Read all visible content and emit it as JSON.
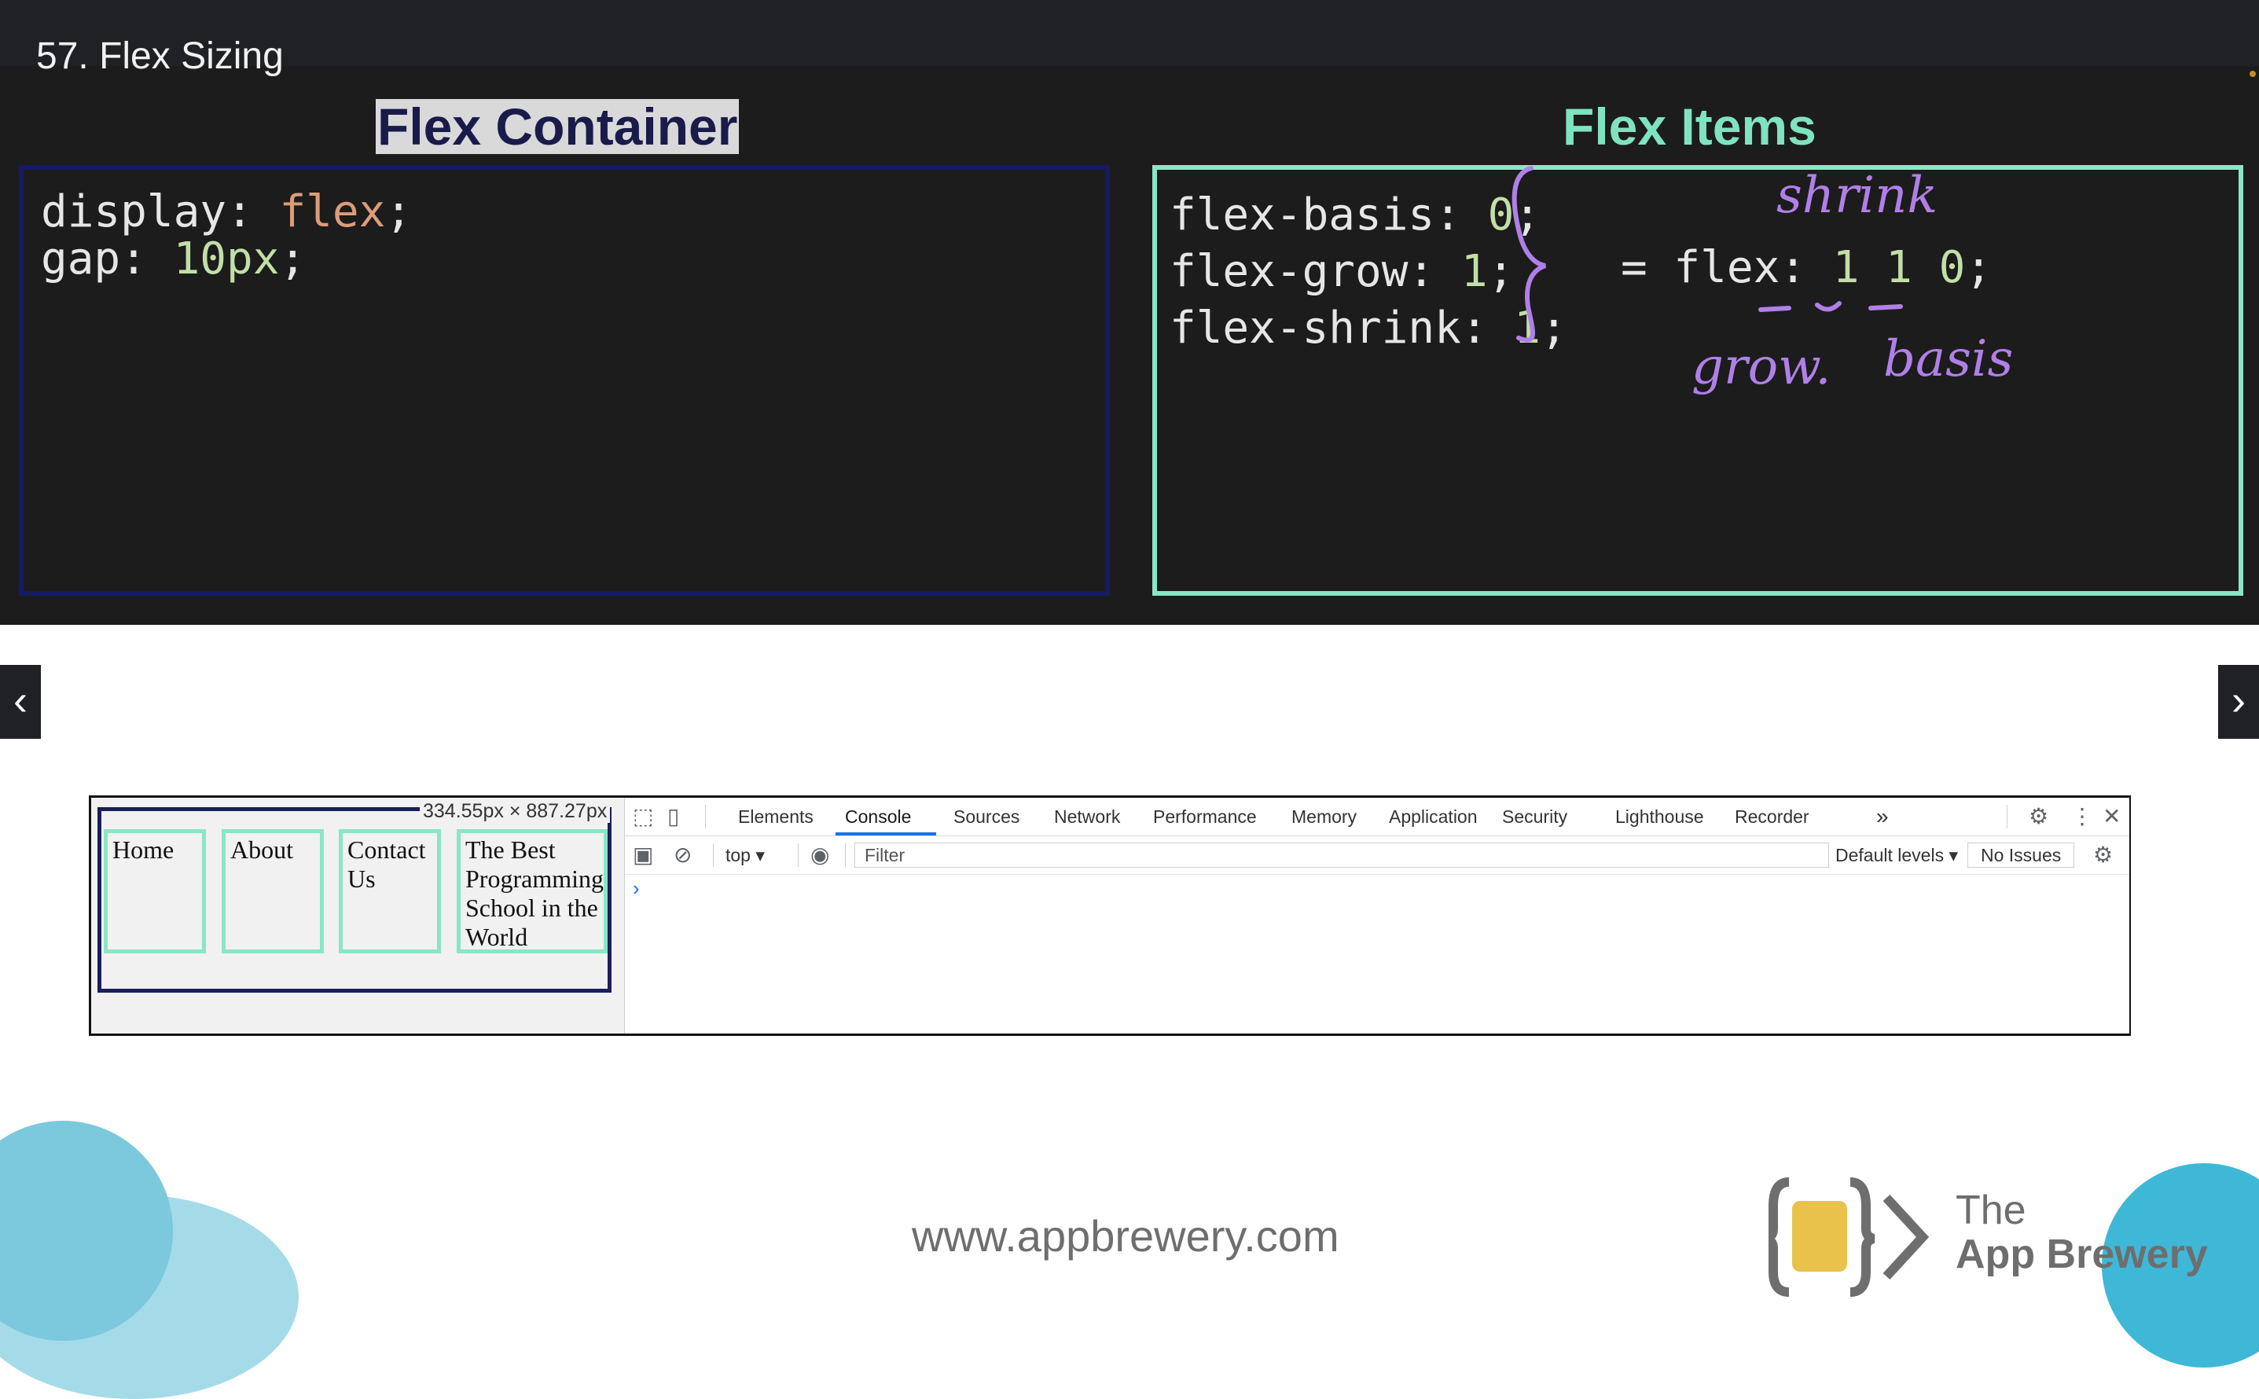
{
  "header": {
    "lesson_title": "57. Flex Sizing"
  },
  "slide": {
    "left_heading": "Flex Container",
    "right_heading": "Flex Items",
    "container_code": {
      "line1_prop": "display: ",
      "line1_value": "flex",
      "line1_end": ";",
      "line2_prop": "gap: ",
      "line2_value": "10px",
      "line2_end": ";"
    },
    "items_code": {
      "line1_prop": "flex-basis: ",
      "line1_value": "0",
      "line2_prop": "flex-grow: ",
      "line2_value": "1",
      "line3_prop": "flex-shrink: ",
      "line3_value": "1",
      "end": ";"
    },
    "shorthand": {
      "prefix": "= flex: ",
      "v1": "1",
      "v2": "1",
      "v3": "0",
      "end": ";"
    },
    "handwriting": {
      "shrink": "shrink",
      "grow": "grow.",
      "basis": "basis"
    },
    "colors": {
      "container_border": "#161a63",
      "items_border": "#8ae6c5",
      "annotation": "#b07fe8"
    }
  },
  "navigation": {
    "prev_icon": "chevron-left-icon",
    "next_icon": "chevron-right-icon"
  },
  "browser": {
    "dimension_label": "334.55px × 887.27px",
    "items": [
      "Home",
      "About",
      "Contact Us",
      "The Best Programming School in the World"
    ]
  },
  "devtools": {
    "tabs": [
      "Elements",
      "Console",
      "Sources",
      "Network",
      "Performance",
      "Memory",
      "Application",
      "Security",
      "Lighthouse",
      "Recorder"
    ],
    "active_tab": "Console",
    "more_tabs": "»",
    "context": "top ▾",
    "filter_placeholder": "Filter",
    "levels": "Default levels ▾",
    "issues": "No Issues",
    "prompt": "›"
  },
  "footer": {
    "url": "www.appbrewery.com",
    "logo_line1": "The",
    "logo_line2": "App Brewery"
  }
}
